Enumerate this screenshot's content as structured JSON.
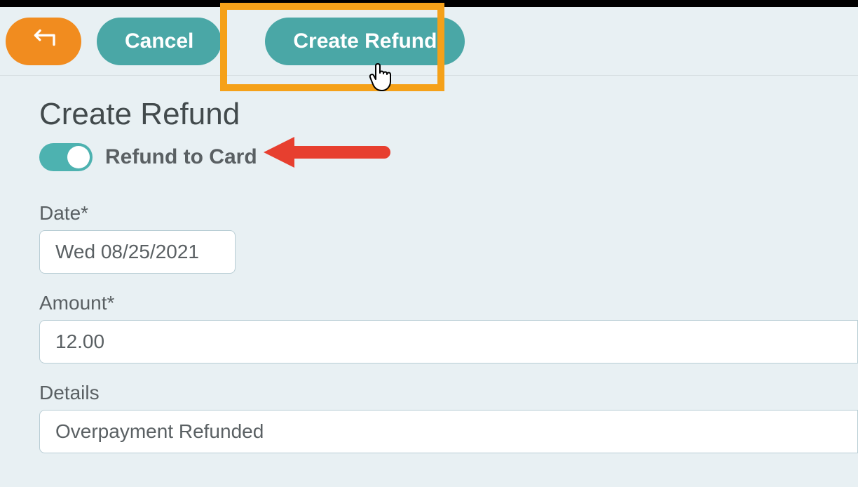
{
  "toolbar": {
    "cancel_label": "Cancel",
    "create_refund_label": "Create Refund"
  },
  "page": {
    "title": "Create Refund",
    "toggle_label": "Refund to Card"
  },
  "form": {
    "date_label": "Date*",
    "date_value": "Wed 08/25/2021",
    "amount_label": "Amount*",
    "amount_value": "12.00",
    "details_label": "Details",
    "details_value": "Overpayment Refunded"
  }
}
